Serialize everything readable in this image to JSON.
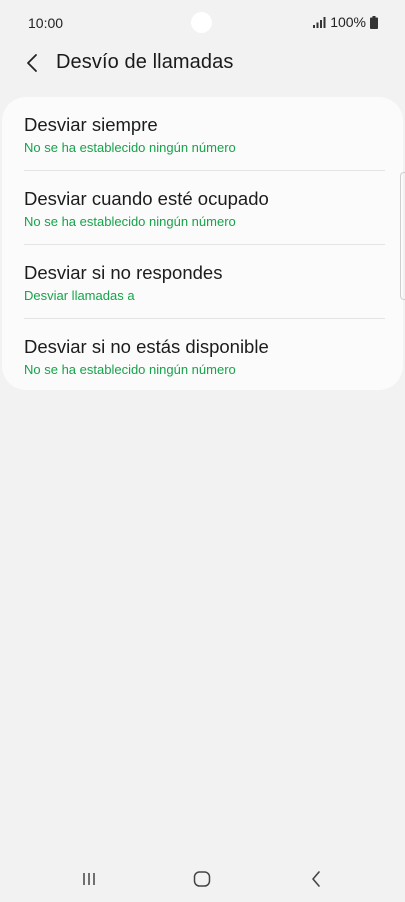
{
  "status_bar": {
    "time": "10:00",
    "battery": "100%",
    "icons": [
      "signal-icon",
      "battery-icon"
    ]
  },
  "header": {
    "title": "Desvío de llamadas",
    "back_icon": "chevron-left-icon"
  },
  "forward_options": [
    {
      "title": "Desviar siempre",
      "subtitle": "No se ha establecido ningún número"
    },
    {
      "title": "Desviar cuando esté ocupado",
      "subtitle": "No se ha establecido ningún número"
    },
    {
      "title": "Desviar si no respondes",
      "subtitle": "Desviar llamadas a"
    },
    {
      "title": "Desviar si no estás disponible",
      "subtitle": "No se ha establecido ningún número"
    }
  ],
  "nav_bar": {
    "icons": [
      "recent-apps-icon",
      "home-icon",
      "back-icon"
    ]
  },
  "colors": {
    "background": "#f2f2f2",
    "card": "#fbfbfb",
    "accent": "#16a34a"
  }
}
